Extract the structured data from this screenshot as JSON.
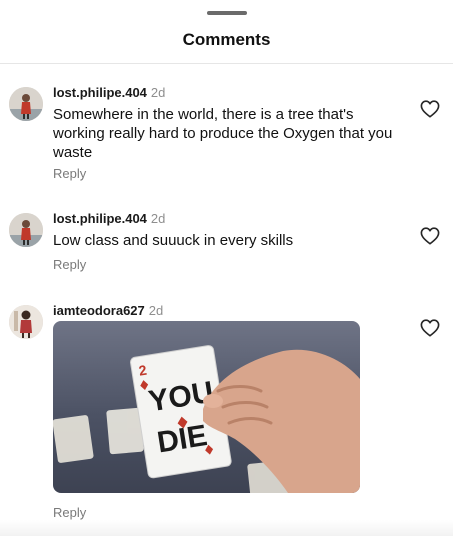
{
  "header": {
    "title": "Comments"
  },
  "comments": [
    {
      "username": "lost.philipe.404",
      "time": "2d",
      "text": "Somewhere in the world, there is a tree that's working really hard to produce the Oxygen that you waste",
      "reply_label": "Reply"
    },
    {
      "username": "lost.philipe.404",
      "time": "2d",
      "text": "Low class and suuuck in every skills",
      "reply_label": "Reply"
    },
    {
      "username": "iamteodora627",
      "time": "2d",
      "media": {
        "card_rank": "2",
        "card_text_line1": "YOU",
        "card_text_line2": "DIE"
      },
      "reply_label": "Reply"
    }
  ],
  "colors": {
    "text": "#111111",
    "muted": "#8e8e8e",
    "divider": "#e6e6e6"
  },
  "icons": {
    "like": "heart-outline-icon",
    "grabber": "drag-handle"
  }
}
